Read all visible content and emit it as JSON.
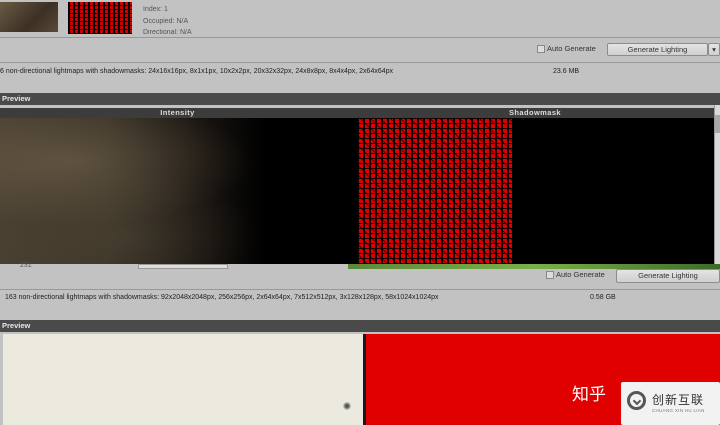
{
  "top_panel": {
    "info_lines": [
      "Index: 1",
      "Occupied: N/A",
      "Directional: N/A"
    ],
    "auto_generate_label": "Auto Generate",
    "generate_lighting_label": "Generate Lighting",
    "dropdown_glyph": "▾",
    "summary": "6 non-directional lightmaps with shadowmasks: 24x16x16px, 8x1x1px, 10x2x2px, 20x32x32px, 24x8x8px, 8x4x4px, 2x64x64px",
    "size": "23.6 MB"
  },
  "preview_top": {
    "title": "Preview",
    "columns": [
      "Intensity",
      "Shadowmask"
    ]
  },
  "middle_panel": {
    "left_number": "231",
    "auto_generate_label": "Auto Generate",
    "generate_lighting_label": "Generate Lighting",
    "summary": "163 non-directional lightmaps with shadowmasks: 92x2048x2048px, 256x256px, 2x64x64px, 7x512x512px, 3x128x128px, 58x1024x1024px",
    "size": "0.58 GB"
  },
  "preview_bottom": {
    "title": "Preview"
  },
  "watermark": {
    "zhihu": "知乎",
    "brand": "创新互联",
    "brand_sub": "CHUANG XIN HU LIAN"
  },
  "colors": {
    "panel_bg": "#c2c2c2",
    "preview_bar": "#4a4a4a",
    "shadowmask_red": "#dd0000"
  }
}
